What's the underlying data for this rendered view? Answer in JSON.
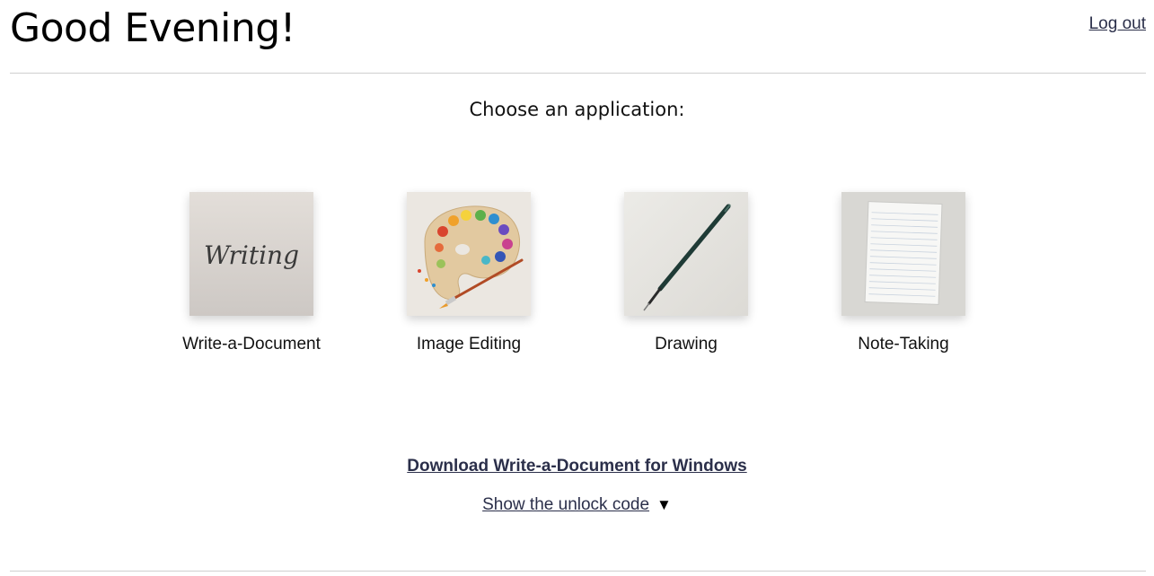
{
  "header": {
    "greeting": "Good Evening!",
    "logout_label": "Log out"
  },
  "main": {
    "subtitle": "Choose an application:",
    "apps": [
      {
        "label": "Write-a-Document",
        "thumbnail_text": "Writing",
        "icon": "writing-thumbnail"
      },
      {
        "label": "Image Editing",
        "icon": "palette-thumbnail"
      },
      {
        "label": "Drawing",
        "icon": "pen-thumbnail"
      },
      {
        "label": "Note-Taking",
        "icon": "notepad-thumbnail"
      }
    ]
  },
  "footer": {
    "download_label": "Download Write-a-Document for Windows",
    "unlock_label": "Show the unlock code",
    "unlock_arrow": "▼"
  },
  "colors": {
    "link": "#2b2f4a",
    "divider": "#cfcfcf",
    "text": "#111111"
  }
}
